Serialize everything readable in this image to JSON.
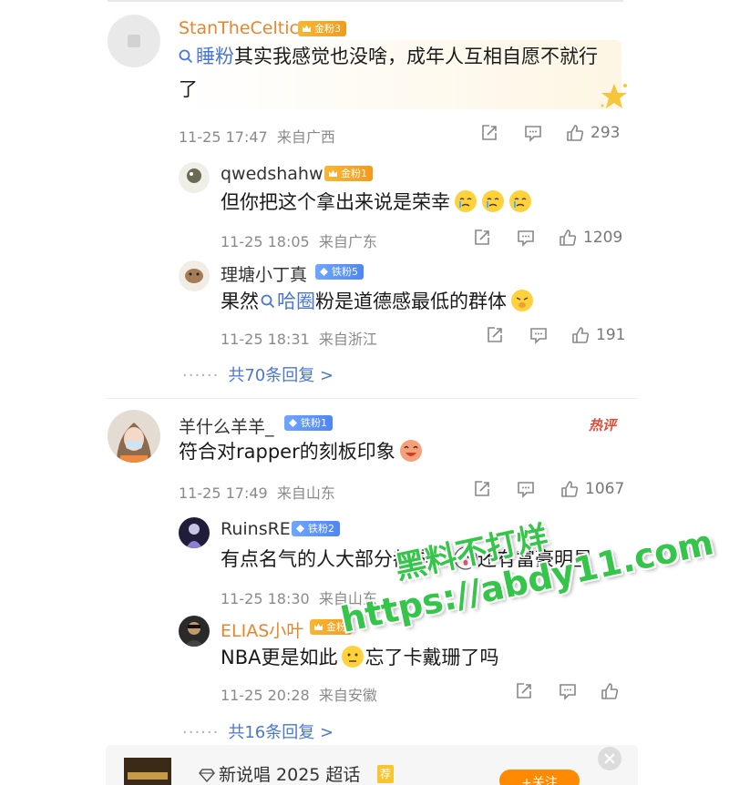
{
  "comments": [
    {
      "username": "StanTheCeltic",
      "badge": "金粉3",
      "text_parts": [
        {
          "t": "睡粉",
          "link": true
        },
        {
          "t": "其实我感觉也没啥，成年人互相自愿不就行",
          "link": false
        }
      ],
      "text_line2": "了",
      "time": "11-25 17:47",
      "location": "来自广西",
      "likes": "293",
      "replies": [
        {
          "username": "qwedshahw",
          "badge": "金粉1",
          "text": "但你把这个拿出来说是荣幸",
          "time": "11-25 18:05",
          "location": "来自广东",
          "likes": "1209"
        },
        {
          "username": "理塘小丁真",
          "badge": "铁粉5",
          "text_before": "果然",
          "text_link": "哈圈",
          "text_after": "粉是道德感最低的群体",
          "time": "11-25 18:31",
          "location": "来自浙江",
          "likes": "191"
        }
      ],
      "more_replies": "共70条回复 >"
    },
    {
      "username": "羊什么羊羊_",
      "badge": "铁粉1",
      "hot_tag": "热评",
      "text": "符合对rapper的刻板印象",
      "time": "11-25 17:49",
      "location": "来自山东",
      "likes": "1067",
      "replies": [
        {
          "username": "RuinsRE",
          "badge": "铁粉2",
          "text": "有点名气的人大部分都这样",
          "text_after": "还有富豪明星",
          "time": "11-25 18:30",
          "location": "来自山东"
        },
        {
          "username": "ELIAS小叶",
          "badge": "金粉",
          "text_before": "NBA更是如此",
          "text_after": "忘了卡戴珊了吗",
          "time": "11-25 20:28",
          "location": "来自安徽"
        }
      ],
      "more_replies": "共16条回复 >"
    }
  ],
  "watermark": {
    "line1": "黑料不打烊",
    "line2": "https://abdy11.com"
  },
  "bottom_bar": {
    "topic": "新说唱 2025 超话",
    "tag": "荐",
    "button": "+关注"
  },
  "colors": {
    "link": "#4a76d3",
    "gold_name": "#e8852a",
    "watermark": "#35c54a",
    "hot": "#e14b3b"
  }
}
